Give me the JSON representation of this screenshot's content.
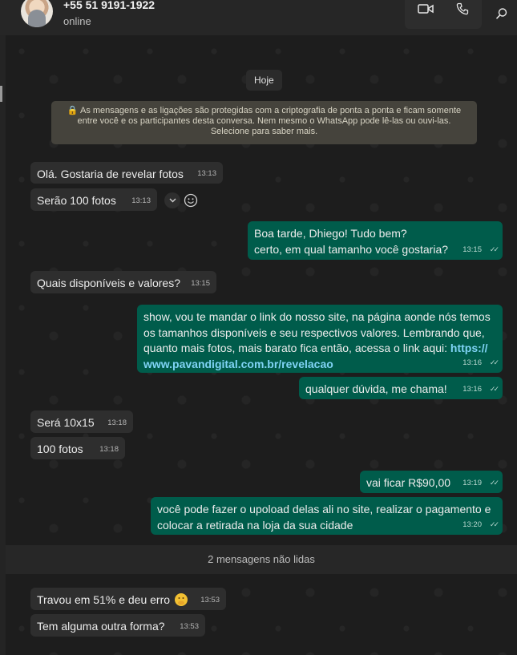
{
  "contact": {
    "phone": "+55 51 9191-1922",
    "status": "online"
  },
  "header_icons": [
    "video-call-icon",
    "phone-call-icon",
    "search-icon"
  ],
  "date_label": "Hoje",
  "encryption_notice": "🔒 As mensagens e as ligações são protegidas com a criptografia de ponta a ponta e ficam somente entre você e os participantes desta conversa. Nem mesmo o WhatsApp pode lê-las ou ouvi-las. Selecione para saber mais.",
  "messages": [
    {
      "dir": "in",
      "text": "Olá. Gostaria de revelar fotos",
      "time": "13:13"
    },
    {
      "dir": "in",
      "text": "Serão 100 fotos",
      "time": "13:13"
    },
    {
      "dir": "out",
      "lines": [
        "Boa tarde, Dhiego! Tudo bem?",
        "certo, em qual tamanho você gostaria?"
      ],
      "time": "13:15"
    },
    {
      "dir": "in",
      "text": "Quais disponíveis e valores?",
      "time": "13:15"
    },
    {
      "dir": "out",
      "text": "show, vou te mandar o link do nosso site, na página aonde nós temos os tamanhos disponíveis e seu respectivos valores. Lembrando que, quanto mais fotos, mais barato fica então, acessa o link aqui: ",
      "link": "https://www.pavandigital.com.br/revelacao",
      "time": "13:16"
    },
    {
      "dir": "out",
      "text": "qualquer dúvida, me chama!",
      "time": "13:16"
    },
    {
      "dir": "in",
      "text": "Será 10x15",
      "time": "13:18"
    },
    {
      "dir": "in",
      "text": "100 fotos",
      "time": "13:18"
    },
    {
      "dir": "out",
      "text": "vai ficar R$90,00",
      "time": "13:19"
    },
    {
      "dir": "out",
      "text": "você pode fazer o upoload delas ali no site, realizar o pagamento e colocar a retirada na loja da sua cidade",
      "time": "13:20"
    },
    {
      "dir": "in",
      "text": "Travou em 51% e deu erro",
      "emoji": "face-with-hand-over-mouth",
      "time": "13:53"
    },
    {
      "dir": "in",
      "text": "Tem alguma outra forma?",
      "time": "13:53"
    }
  ],
  "unread_label": "2 mensagens não lidas"
}
